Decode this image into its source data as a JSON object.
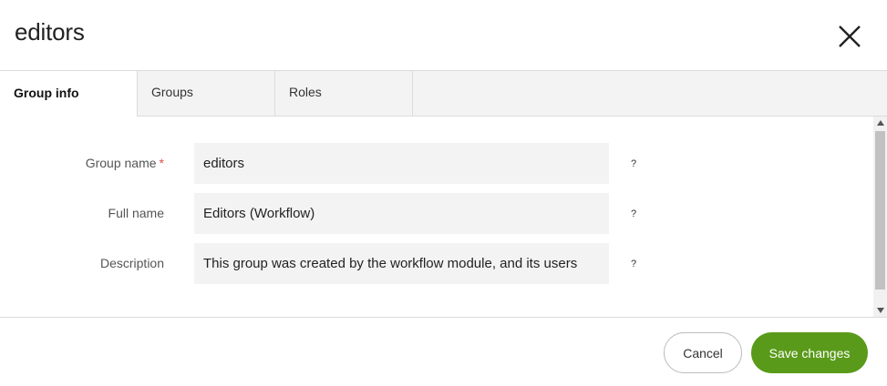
{
  "dialog": {
    "title": "editors",
    "close_icon": "close-icon"
  },
  "tabs": [
    {
      "label": "Group info",
      "active": true
    },
    {
      "label": "Groups",
      "active": false
    },
    {
      "label": "Roles",
      "active": false
    }
  ],
  "form": {
    "group_name": {
      "label": "Group name",
      "required_marker": "*",
      "value": "editors",
      "help": "?"
    },
    "full_name": {
      "label": "Full name",
      "value": "Editors (Workflow)",
      "help": "?"
    },
    "description": {
      "label": "Description",
      "value": "This group was created by the workflow module, and its users",
      "help": "?"
    }
  },
  "footer": {
    "cancel_label": "Cancel",
    "save_label": "Save changes"
  },
  "colors": {
    "accent": "#5a9a1a",
    "required": "#d9534f",
    "field_bg": "#f3f3f3"
  }
}
